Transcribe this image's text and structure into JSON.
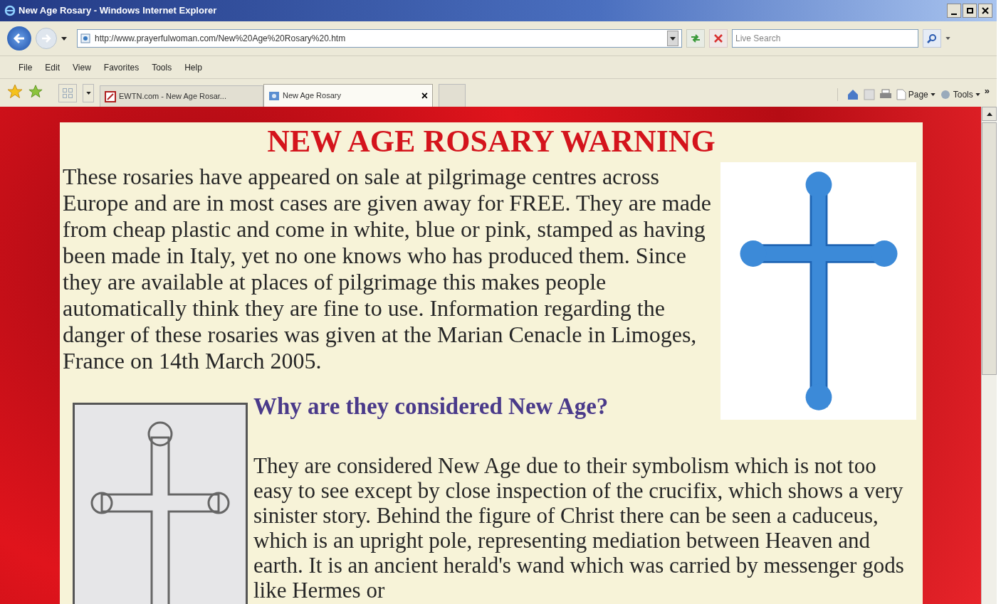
{
  "window": {
    "title": "New Age Rosary - Windows Internet Explorer"
  },
  "address_bar": {
    "url": "http://www.prayerfulwoman.com/New%20Age%20Rosary%20.htm"
  },
  "search": {
    "placeholder": "Live Search"
  },
  "menu": [
    "File",
    "Edit",
    "View",
    "Favorites",
    "Tools",
    "Help"
  ],
  "tabs": [
    {
      "label": "EWTN.com - New Age Rosar...",
      "selected": false
    },
    {
      "label": "New Age Rosary",
      "selected": true
    }
  ],
  "tab_close": "×",
  "command_bar": {
    "items": [
      "Page",
      "Tools"
    ],
    "overflow": "»"
  },
  "page": {
    "title": "NEW AGE ROSARY WARNING",
    "intro": "These rosaries have appeared on sale at pilgrimage centres across Europe and are in most cases are given away for FREE. They are made from cheap plastic and come in white, blue or pink, stamped as having been made in Italy, yet no one knows who has produced them. Since they are available at places of pilgrimage this makes people automatically think they are fine to use. Information regarding the danger of these rosaries was given at the Marian Cenacle in Limoges, France on 14th March 2005.",
    "heading": "Why are they considered New Age?",
    "body": "They are considered New Age due to their symbolism which is not too easy to see except by close inspection of the crucifix, which shows a very sinister story. Behind the figure of Christ there can be seen a caduceus, which is an upright pole, representing mediation between Heaven and earth. It is an ancient herald's wand which was carried by messenger gods like Hermes or"
  }
}
